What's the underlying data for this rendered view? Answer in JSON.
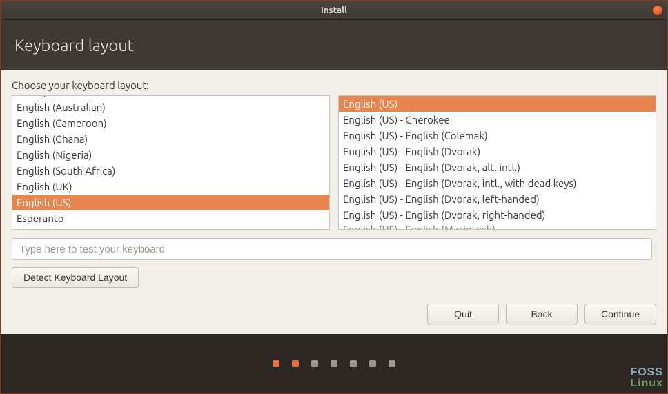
{
  "window": {
    "title": "Install"
  },
  "header": {
    "title": "Keyboard layout"
  },
  "prompt": "Choose your keyboard layout:",
  "left_list": {
    "items": [
      "Dzongkha",
      "English (Australian)",
      "English (Cameroon)",
      "English (Ghana)",
      "English (Nigeria)",
      "English (South Africa)",
      "English (UK)",
      "English (US)",
      "Esperanto"
    ],
    "selected_index": 7,
    "first_cut": true
  },
  "right_list": {
    "items": [
      "English (US)",
      "English (US) - Cherokee",
      "English (US) - English (Colemak)",
      "English (US) - English (Dvorak)",
      "English (US) - English (Dvorak, alt. intl.)",
      "English (US) - English (Dvorak, intl., with dead keys)",
      "English (US) - English (Dvorak, left-handed)",
      "English (US) - English (Dvorak, right-handed)",
      "English (US) - English (Macintosh)"
    ],
    "selected_index": 0,
    "last_cut": true
  },
  "test_placeholder": "Type here to test your keyboard",
  "buttons": {
    "detect": "Detect Keyboard Layout",
    "quit": "Quit",
    "back": "Back",
    "continue": "Continue"
  },
  "progress": {
    "total": 7,
    "active": [
      0,
      1
    ]
  },
  "watermark": {
    "line1": "FOSS",
    "line2": "Linux"
  }
}
